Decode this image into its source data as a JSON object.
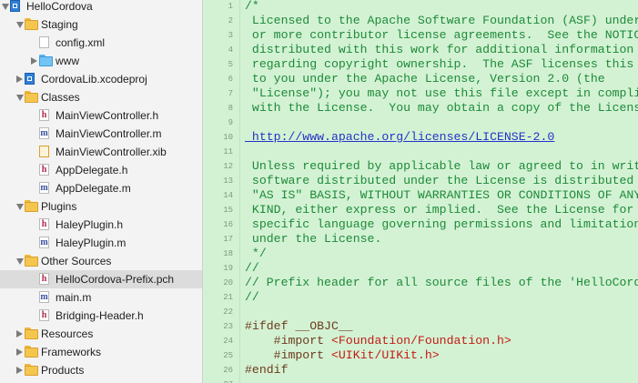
{
  "navigator": {
    "items": [
      {
        "label": "HelloCordova",
        "icon": "xcode-project-icon",
        "disclosure": "open",
        "indent": 0
      },
      {
        "label": "Staging",
        "icon": "folder-icon",
        "disclosure": "open",
        "indent": 1
      },
      {
        "label": "config.xml",
        "icon": "xml-file-icon",
        "disclosure": "none",
        "indent": 2
      },
      {
        "label": "www",
        "icon": "blue-folder-icon",
        "disclosure": "closed",
        "indent": 2
      },
      {
        "label": "CordovaLib.xcodeproj",
        "icon": "xcode-project-icon",
        "disclosure": "closed",
        "indent": 1
      },
      {
        "label": "Classes",
        "icon": "folder-icon",
        "disclosure": "open",
        "indent": 1
      },
      {
        "label": "MainViewController.h",
        "icon": "header-file-icon",
        "disclosure": "none",
        "indent": 2
      },
      {
        "label": "MainViewController.m",
        "icon": "objc-file-icon",
        "disclosure": "none",
        "indent": 2
      },
      {
        "label": "MainViewController.xib",
        "icon": "xib-file-icon",
        "disclosure": "none",
        "indent": 2
      },
      {
        "label": "AppDelegate.h",
        "icon": "header-file-icon",
        "disclosure": "none",
        "indent": 2
      },
      {
        "label": "AppDelegate.m",
        "icon": "objc-file-icon",
        "disclosure": "none",
        "indent": 2
      },
      {
        "label": "Plugins",
        "icon": "folder-icon",
        "disclosure": "open",
        "indent": 1
      },
      {
        "label": "HaleyPlugin.h",
        "icon": "header-file-icon",
        "disclosure": "none",
        "indent": 2
      },
      {
        "label": "HaleyPlugin.m",
        "icon": "objc-file-icon",
        "disclosure": "none",
        "indent": 2
      },
      {
        "label": "Other Sources",
        "icon": "folder-icon",
        "disclosure": "open",
        "indent": 1
      },
      {
        "label": "HelloCordova-Prefix.pch",
        "icon": "header-file-icon",
        "disclosure": "none",
        "indent": 2,
        "selected": true
      },
      {
        "label": "main.m",
        "icon": "objc-file-icon",
        "disclosure": "none",
        "indent": 2
      },
      {
        "label": "Bridging-Header.h",
        "icon": "header-file-icon",
        "disclosure": "none",
        "indent": 2
      },
      {
        "label": "Resources",
        "icon": "folder-icon",
        "disclosure": "closed",
        "indent": 1
      },
      {
        "label": "Frameworks",
        "icon": "folder-icon",
        "disclosure": "closed",
        "indent": 1
      },
      {
        "label": "Products",
        "icon": "folder-icon",
        "disclosure": "closed",
        "indent": 1
      }
    ]
  },
  "editor": {
    "lines": [
      {
        "n": "1",
        "text": "/*",
        "kind": "comment"
      },
      {
        "n": "2",
        "text": " Licensed to the Apache Software Foundation (ASF) under one",
        "kind": "comment"
      },
      {
        "n": "3",
        "text": " or more contributor license agreements.  See the NOTICE file",
        "kind": "comment"
      },
      {
        "n": "4",
        "text": " distributed with this work for additional information",
        "kind": "comment"
      },
      {
        "n": "5",
        "text": " regarding copyright ownership.  The ASF licenses this file",
        "kind": "comment"
      },
      {
        "n": "6",
        "text": " to you under the Apache License, Version 2.0 (the",
        "kind": "comment"
      },
      {
        "n": "7",
        "text": " \"License\"); you may not use this file except in compliance",
        "kind": "comment"
      },
      {
        "n": "8",
        "text": " with the License.  You may obtain a copy of the License at",
        "kind": "comment"
      },
      {
        "n": "9",
        "text": "",
        "kind": "comment"
      },
      {
        "n": "10",
        "text": " http://www.apache.org/licenses/LICENSE-2.0",
        "kind": "link"
      },
      {
        "n": "11",
        "text": "",
        "kind": "comment"
      },
      {
        "n": "12",
        "text": " Unless required by applicable law or agreed to in writing,",
        "kind": "comment"
      },
      {
        "n": "13",
        "text": " software distributed under the License is distributed on an",
        "kind": "comment"
      },
      {
        "n": "14",
        "text": " \"AS IS\" BASIS, WITHOUT WARRANTIES OR CONDITIONS OF ANY",
        "kind": "comment"
      },
      {
        "n": "15",
        "text": " KIND, either express or implied.  See the License for the",
        "kind": "comment"
      },
      {
        "n": "16",
        "text": " specific language governing permissions and limitations",
        "kind": "comment"
      },
      {
        "n": "17",
        "text": " under the License.",
        "kind": "comment"
      },
      {
        "n": "18",
        "text": " */",
        "kind": "comment"
      },
      {
        "n": "19",
        "text": "//",
        "kind": "comment"
      },
      {
        "n": "20",
        "text": "// Prefix header for all source files of the 'HelloCordova' target",
        "kind": "comment"
      },
      {
        "n": "21",
        "text": "//",
        "kind": "comment"
      },
      {
        "n": "22",
        "text": "",
        "kind": "comment"
      },
      {
        "n": "23",
        "text": "#ifdef __OBJC__",
        "kind": "pp"
      },
      {
        "n": "24",
        "text": "    #import ",
        "kind": "pp",
        "str": "<Foundation/Foundation.h>"
      },
      {
        "n": "25",
        "text": "    #import ",
        "kind": "pp",
        "str": "<UIKit/UIKit.h>"
      },
      {
        "n": "26",
        "text": "#endif",
        "kind": "pp"
      },
      {
        "n": "27",
        "text": "",
        "kind": "comment"
      }
    ]
  },
  "colors": {
    "editor_bg": "#d3f2d3",
    "comment": "#1d8a3a",
    "link": "#2433c9",
    "preprocessor": "#6e3a1e",
    "string": "#c41a16",
    "selection": "#dcdcdc"
  }
}
